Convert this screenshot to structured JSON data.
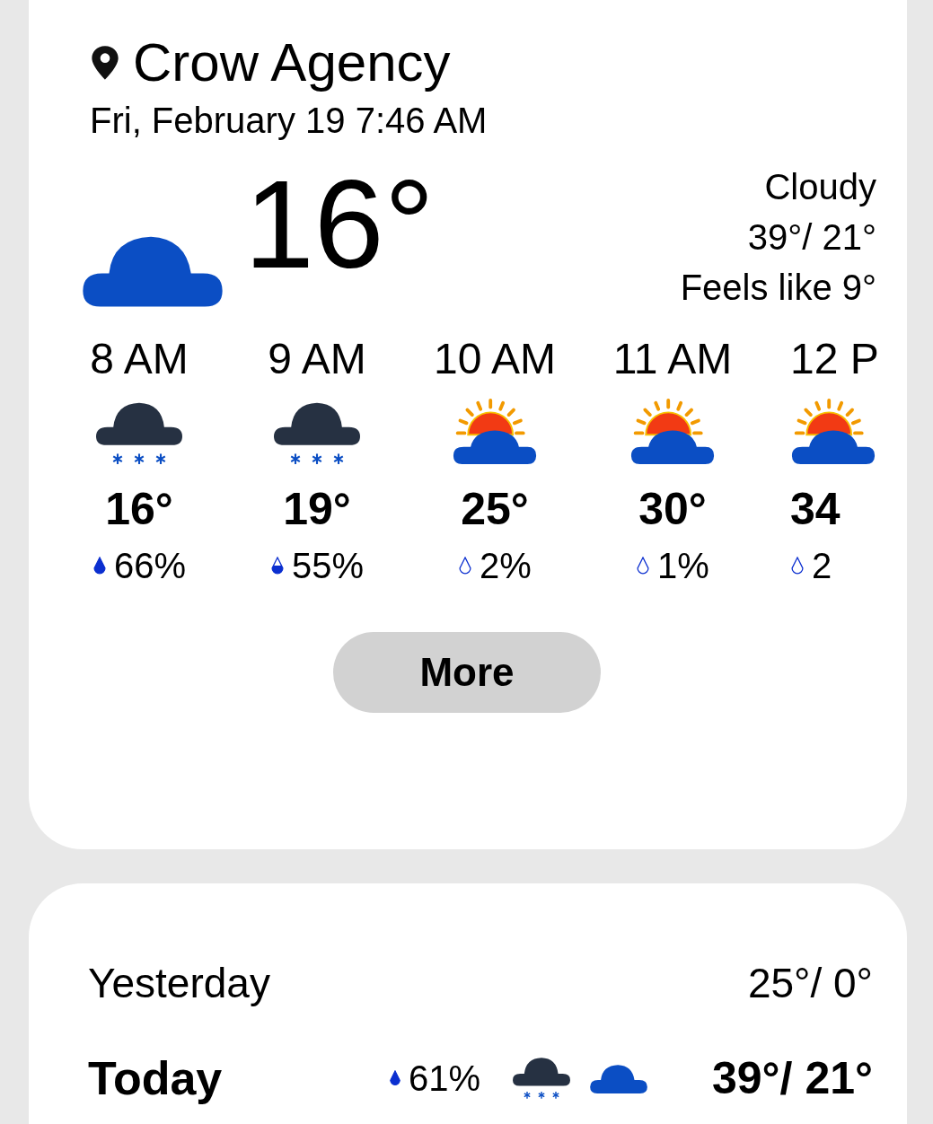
{
  "location": {
    "name": "Crow Agency",
    "datetime": "Fri, February 19 7:46 AM"
  },
  "current": {
    "kind": "cloudy",
    "temperature": "16°",
    "condition": "Cloudy",
    "high_low": "39°/ 21°",
    "feels_like": "Feels like 9°"
  },
  "hourly": [
    {
      "time": "8 AM",
      "kind": "snow",
      "temperature": "16°",
      "precipitation": {
        "kind": "full",
        "text": "66%"
      }
    },
    {
      "time": "9 AM",
      "kind": "snow",
      "temperature": "19°",
      "precipitation": {
        "kind": "half",
        "text": "55%"
      }
    },
    {
      "time": "10 AM",
      "kind": "partly_sunny",
      "temperature": "25°",
      "precipitation": {
        "kind": "empty",
        "text": "2%"
      }
    },
    {
      "time": "11 AM",
      "kind": "partly_sunny",
      "temperature": "30°",
      "precipitation": {
        "kind": "empty",
        "text": "1%"
      }
    },
    {
      "time": "12 P",
      "kind": "partly_sunny",
      "temperature": "34",
      "precipitation": {
        "kind": "empty",
        "text": "2"
      }
    }
  ],
  "more_button": "More",
  "daily": [
    {
      "day": "Yesterday",
      "bold": false,
      "high_low": "25°/ 0°"
    },
    {
      "day": "Today",
      "bold": true,
      "precipitation": {
        "kind": "full",
        "text": "61%"
      },
      "icons": [
        {
          "kind": "snow"
        },
        {
          "kind": "cloudy"
        }
      ],
      "high_low": "39°/ 21°"
    }
  ]
}
